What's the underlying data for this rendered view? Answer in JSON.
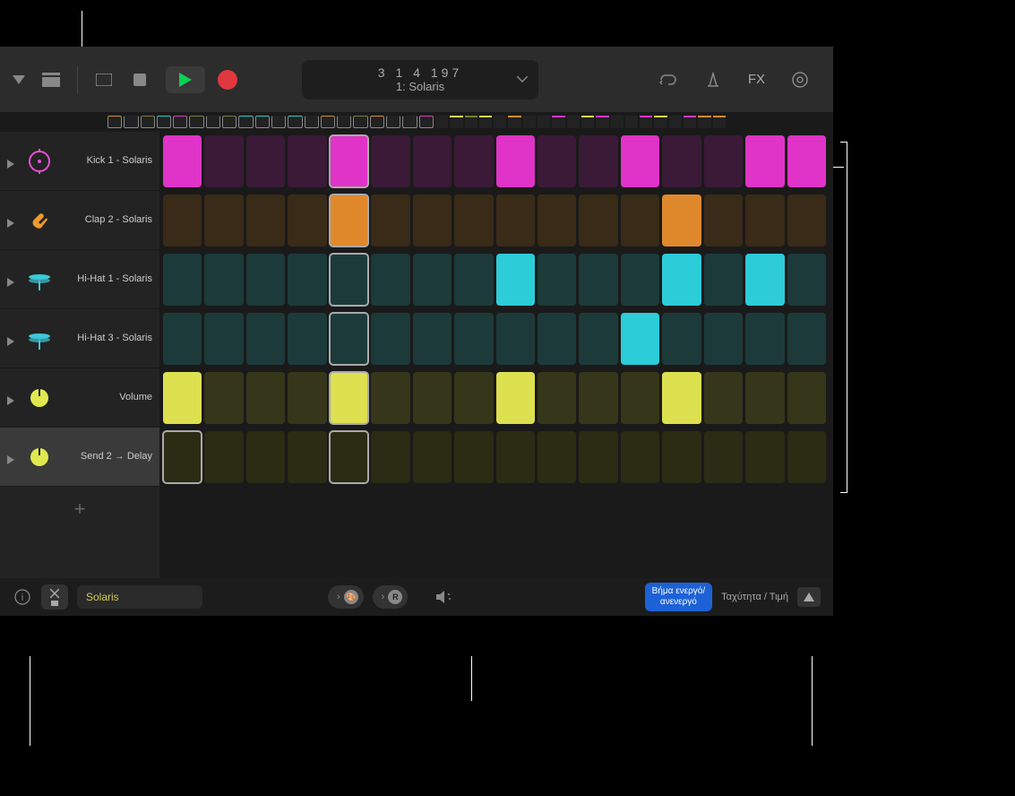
{
  "toolbar": {
    "lcd_top": "3  1  4  197",
    "lcd_bottom": "1: Solaris",
    "fx": "FX"
  },
  "tracks": [
    {
      "label": "Kick 1 - Solaris",
      "iconColor": "#e84fd8",
      "iconType": "kick"
    },
    {
      "label": "Clap 2 - Solaris",
      "iconColor": "#f09a2c",
      "iconType": "clap"
    },
    {
      "label": "Hi-Hat 1 - Solaris",
      "iconColor": "#3cc9d9",
      "iconType": "hihat"
    },
    {
      "label": "Hi-Hat 3 - Solaris",
      "iconColor": "#3cc9d9",
      "iconType": "hihat"
    },
    {
      "label": "Volume",
      "iconColor": "#e0e84f",
      "iconType": "knob"
    },
    {
      "label": "Send 2 → Delay",
      "iconColor": "#e0e84f",
      "iconType": "knob",
      "selected": true
    }
  ],
  "grid": {
    "playheadCol": 4,
    "colors": {
      "kick_on": "#e033c7",
      "kick_off": "#3a1a36",
      "clap_on": "#e0892c",
      "clap_off": "#3a2a18",
      "hihat_on": "#2cccd9",
      "hihat_off": "#1d3a3a",
      "vol_on": "#dde04f",
      "vol_off": "#35361a",
      "send_on": "#7a7d2c",
      "send_off": "#2a2c14"
    },
    "rows": [
      {
        "c": "kick",
        "on": [
          0,
          4,
          8,
          11,
          14,
          15
        ]
      },
      {
        "c": "clap",
        "on": [
          4,
          12
        ]
      },
      {
        "c": "hihat",
        "on": [
          8,
          12,
          14
        ]
      },
      {
        "c": "hihat",
        "on": [
          11
        ]
      },
      {
        "c": "vol",
        "on": [
          0,
          4,
          8,
          12
        ]
      },
      {
        "c": "send",
        "on": []
      }
    ]
  },
  "bottombar": {
    "preset_name": "Solaris",
    "pill_r": "R",
    "step_toggle": "Βήμα ενεργό/\nανενεργό",
    "velocity": "Ταχύτητα / Τιμή"
  }
}
